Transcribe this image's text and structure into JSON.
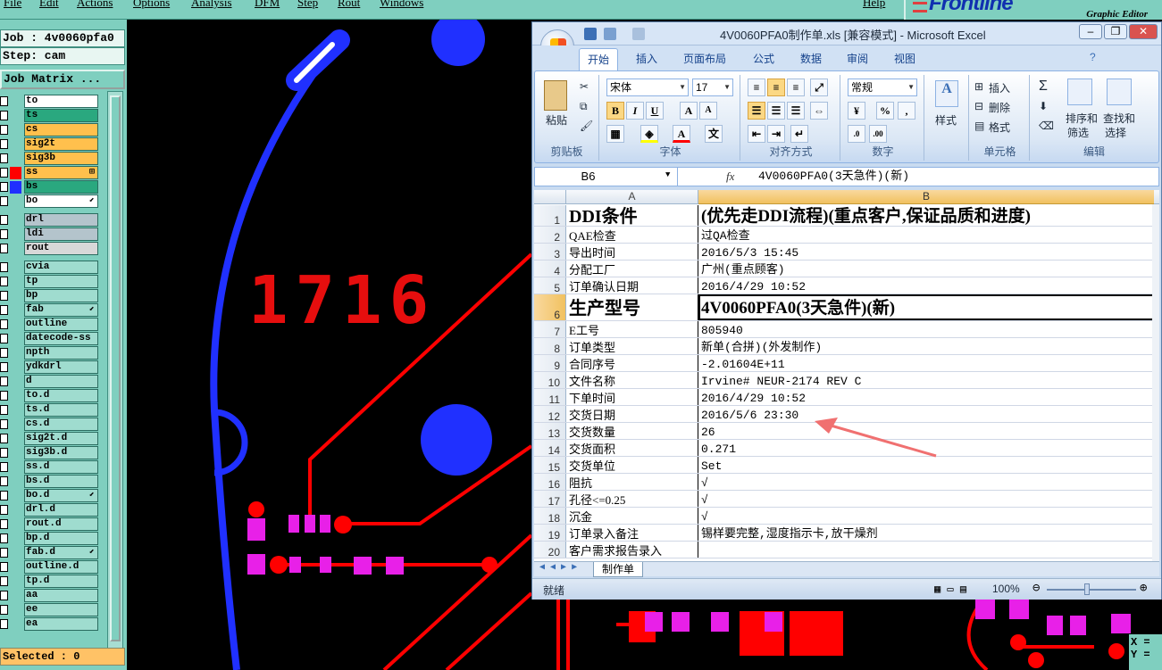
{
  "genesis": {
    "menu": [
      "File",
      "Edit",
      "Actions",
      "Options",
      "Analysis",
      "DFM",
      "Step",
      "Rout",
      "Windows"
    ],
    "help": "Help",
    "brand": "Frontline",
    "brand_sub": "Graphic Editor",
    "job_line": "Job : 4v0060pfa0",
    "step_line": "Step: cam",
    "job_matrix": "Job Matrix ...",
    "layers": [
      {
        "name": "to",
        "color": "#ffffff",
        "mark": ""
      },
      {
        "name": "ts",
        "color": "#2aa87f",
        "mark": ""
      },
      {
        "name": "cs",
        "color": "#ffc04d",
        "mark": ""
      },
      {
        "name": "sig2t",
        "color": "#ffc04d",
        "mark": ""
      },
      {
        "name": "sig3b",
        "color": "#ffc04d",
        "mark": ""
      },
      {
        "name": "ss",
        "color": "#ffc04d",
        "mark": "⊞"
      },
      {
        "name": "bs",
        "color": "#2aa87f",
        "mark": ""
      },
      {
        "name": "bo",
        "color": "#ffffff",
        "mark": "⬋"
      },
      {
        "name": "drl",
        "color": "#b4c4cc",
        "mark": ""
      },
      {
        "name": "ldi",
        "color": "#b4c4cc",
        "mark": ""
      },
      {
        "name": "rout",
        "color": "#d8d8d8",
        "mark": ""
      },
      {
        "name": "cvia",
        "color": "#9fdccf",
        "mark": ""
      },
      {
        "name": "tp",
        "color": "#9fdccf",
        "mark": ""
      },
      {
        "name": "bp",
        "color": "#9fdccf",
        "mark": ""
      },
      {
        "name": "fab",
        "color": "#9fdccf",
        "mark": "⬋"
      },
      {
        "name": "outline",
        "color": "#9fdccf",
        "mark": ""
      },
      {
        "name": "datecode-ss",
        "color": "#9fdccf",
        "mark": ""
      },
      {
        "name": "npth",
        "color": "#9fdccf",
        "mark": ""
      },
      {
        "name": "ydkdrl",
        "color": "#9fdccf",
        "mark": ""
      },
      {
        "name": "d",
        "color": "#9fdccf",
        "mark": ""
      },
      {
        "name": "to.d",
        "color": "#9fdccf",
        "mark": ""
      },
      {
        "name": "ts.d",
        "color": "#9fdccf",
        "mark": ""
      },
      {
        "name": "cs.d",
        "color": "#9fdccf",
        "mark": ""
      },
      {
        "name": "sig2t.d",
        "color": "#9fdccf",
        "mark": ""
      },
      {
        "name": "sig3b.d",
        "color": "#9fdccf",
        "mark": ""
      },
      {
        "name": "ss.d",
        "color": "#9fdccf",
        "mark": ""
      },
      {
        "name": "bs.d",
        "color": "#9fdccf",
        "mark": ""
      },
      {
        "name": "bo.d",
        "color": "#9fdccf",
        "mark": "⬋"
      },
      {
        "name": "drl.d",
        "color": "#9fdccf",
        "mark": ""
      },
      {
        "name": "rout.d",
        "color": "#9fdccf",
        "mark": ""
      },
      {
        "name": "bp.d",
        "color": "#9fdccf",
        "mark": ""
      },
      {
        "name": "fab.d",
        "color": "#9fdccf",
        "mark": "⬋"
      },
      {
        "name": "outline.d",
        "color": "#9fdccf",
        "mark": ""
      },
      {
        "name": "tp.d",
        "color": "#9fdccf",
        "mark": ""
      },
      {
        "name": "aa",
        "color": "#9fdccf",
        "mark": ""
      },
      {
        "name": "ee",
        "color": "#9fdccf",
        "mark": ""
      },
      {
        "name": "ea",
        "color": "#9fdccf",
        "mark": ""
      }
    ],
    "selected": "Selected : 0",
    "pcb_text": "1716",
    "coord_x": "X =",
    "coord_y": "Y ="
  },
  "excel": {
    "title": "4V0060PFA0制作单.xls [兼容模式] - Microsoft Excel",
    "tabs": [
      "开始",
      "插入",
      "页面布局",
      "公式",
      "数据",
      "审阅",
      "视图"
    ],
    "ribbon": {
      "paste": "粘贴",
      "clipboard": "剪贴板",
      "font_name": "宋体",
      "font_size": "17",
      "font_group": "字体",
      "align_group": "对齐方式",
      "number_format": "常规",
      "number_group": "数字",
      "styles": "样式",
      "insert": "插入",
      "delete": "删除",
      "format": "格式",
      "cells_group": "单元格",
      "sort": "排序和",
      "sort2": "筛选",
      "find": "查找和",
      "find2": "选择",
      "edit_group": "编辑",
      "sigma": "Σ",
      "percent": "%",
      "comma": ","
    },
    "name_box": "B6",
    "fx": "fx",
    "formula": "4V0060PFA0(3天急件)(新)",
    "col_a": "A",
    "col_b": "B",
    "rows": [
      {
        "n": "1",
        "a": "DDI条件",
        "b": "(优先走DDI流程)(重点客户,保证品质和进度)"
      },
      {
        "n": "2",
        "a": "QAE检查",
        "b": "过QA检查"
      },
      {
        "n": "3",
        "a": "导出时间",
        "b": "2016/5/3 15:45"
      },
      {
        "n": "4",
        "a": "分配工厂",
        "b": "广州(重点顾客)"
      },
      {
        "n": "5",
        "a": "订单确认日期",
        "b": "2016/4/29 10:52"
      },
      {
        "n": "6",
        "a": "生产型号",
        "b": "4V0060PFA0(3天急件)(新)"
      },
      {
        "n": "7",
        "a": "E工号",
        "b": "805940"
      },
      {
        "n": "8",
        "a": "订单类型",
        "b": "新单(合拼)(外发制作)"
      },
      {
        "n": "9",
        "a": "合同序号",
        "b": "-2.01604E+11"
      },
      {
        "n": "10",
        "a": "文件名称",
        "b": "Irvine# NEUR-2174 REV C"
      },
      {
        "n": "11",
        "a": "下单时间",
        "b": "2016/4/29 10:52"
      },
      {
        "n": "12",
        "a": "交货日期",
        "b": "2016/5/6 23:30"
      },
      {
        "n": "13",
        "a": "交货数量",
        "b": "26"
      },
      {
        "n": "14",
        "a": "交货面积",
        "b": "0.271"
      },
      {
        "n": "15",
        "a": "交货单位",
        "b": "Set"
      },
      {
        "n": "16",
        "a": "阻抗",
        "b": "√"
      },
      {
        "n": "17",
        "a": "孔径<=0.25",
        "b": "√"
      },
      {
        "n": "18",
        "a": "沉金",
        "b": "√"
      },
      {
        "n": "19",
        "a": "订单录入备注",
        "b": "锡样要完整,湿度指示卡,放干燥剂"
      },
      {
        "n": "20",
        "a": "客户需求报告录入",
        "b": ""
      }
    ],
    "sheet_tab": "制作单",
    "status": "就绪",
    "zoom": "100%"
  }
}
